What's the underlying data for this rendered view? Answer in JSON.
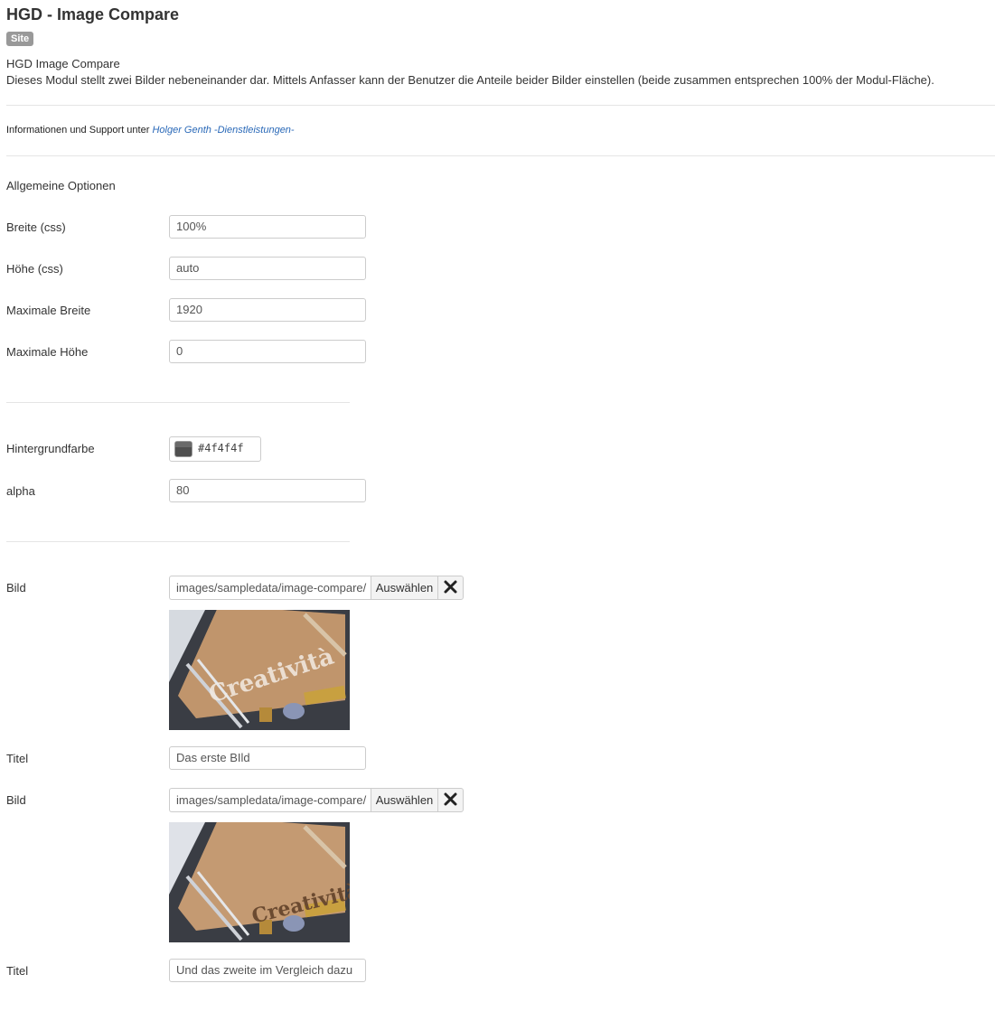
{
  "header": {
    "title": "HGD - Image Compare",
    "badge": "Site",
    "module_name": "HGD Image Compare",
    "description": "Dieses Modul stellt zwei Bilder nebeneinander dar. Mittels Anfasser kann der Benutzer die Anteile beider Bilder einstellen (beide zusammen entsprechen 100% der Modul-Fläche)."
  },
  "info": {
    "prefix": "Informationen und Support unter",
    "link_text": "Holger Genth -Dienstleistungen-"
  },
  "section_title": "Allgemeine Optionen",
  "fields": {
    "width": {
      "label": "Breite (css)",
      "value": "100%"
    },
    "height": {
      "label": "Höhe (css)",
      "value": "auto"
    },
    "max_width": {
      "label": "Maximale Breite",
      "value": "1920"
    },
    "max_height": {
      "label": "Maximale Höhe",
      "value": "0"
    },
    "bgcolor": {
      "label": "Hintergrundfarbe",
      "value": "#4f4f4f"
    },
    "alpha": {
      "label": "alpha",
      "value": "80"
    }
  },
  "images": [
    {
      "label": "Bild",
      "path": "images/sampledata/image-compare/",
      "select_label": "Auswählen",
      "preview_text": "Creatività",
      "title_label": "Titel",
      "title_value": "Das erste BIld"
    },
    {
      "label": "Bild",
      "path": "images/sampledata/image-compare/",
      "select_label": "Auswählen",
      "preview_text": "Creatività",
      "title_label": "Titel",
      "title_value": "Und das zweite im Vergleich dazu"
    }
  ],
  "colors": {
    "accent_link": "#2a69b8",
    "badge": "#999999",
    "swatch": "#4f4f4f"
  }
}
